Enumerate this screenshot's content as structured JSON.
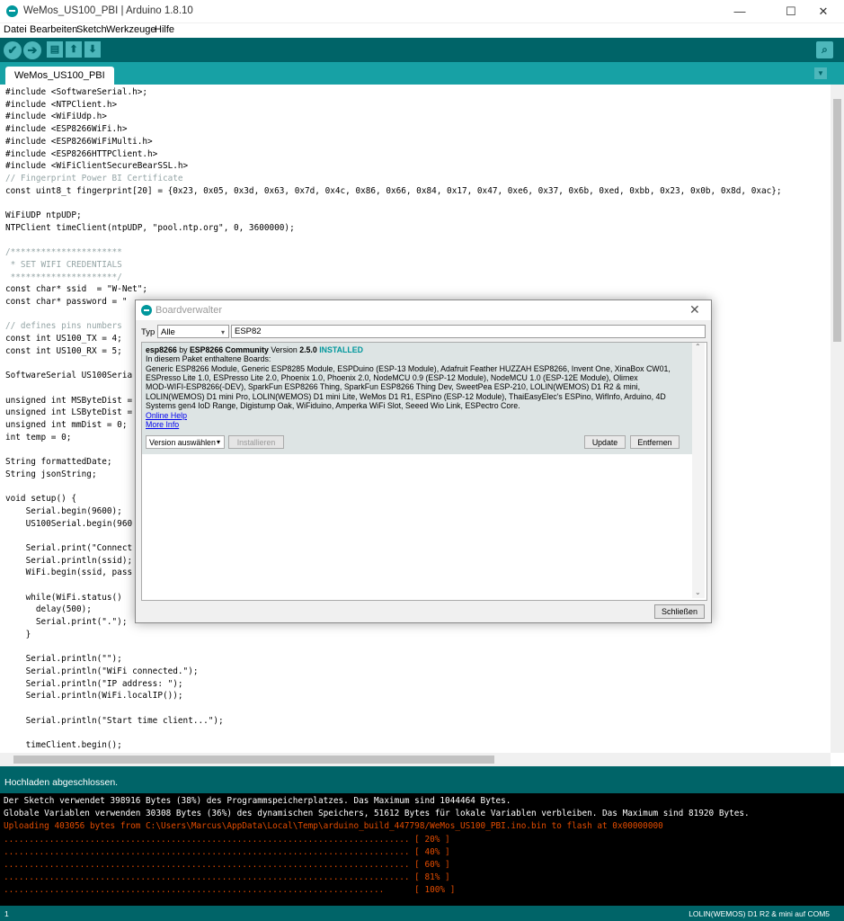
{
  "window": {
    "title": "WeMos_US100_PBI | Arduino 1.8.10",
    "minimize": "—",
    "maximize": "☐",
    "close": "✕"
  },
  "menu": [
    "Datei",
    "Bearbeiten",
    "Sketch",
    "Werkzeuge",
    "Hilfe"
  ],
  "toolbar": {
    "verify_icon": "✔",
    "upload_icon": "➔",
    "new_icon": "▤",
    "open_icon": "⬆",
    "save_icon": "⬇",
    "serial_icon": "⌕"
  },
  "tab": {
    "label": "WeMos_US100_PBI",
    "menu_icon": "▼"
  },
  "code_lines": [
    "#include <SoftwareSerial.h>;",
    "#include <NTPClient.h>",
    "#include <WiFiUdp.h>",
    "#include <ESP8266WiFi.h>",
    "#include <ESP8266WiFiMulti.h>",
    "#include <ESP8266HTTPClient.h>",
    "#include <WiFiClientSecureBearSSL.h>",
    "// Fingerprint Power BI Certificate",
    "const uint8_t fingerprint[20] = {0x23, 0x05, 0x3d, 0x63, 0x7d, 0x4c, 0x86, 0x66, 0x84, 0x17, 0x47, 0xe6, 0x37, 0x6b, 0xed, 0xbb, 0x23, 0x0b, 0x8d, 0xac};",
    "",
    "WiFiUDP ntpUDP;",
    "NTPClient timeClient(ntpUDP, \"pool.ntp.org\", 0, 3600000);",
    "",
    "/**********************",
    " * SET WIFI CREDENTIALS",
    " *********************/",
    "const char* ssid  = \"W-Net\";",
    "const char* password = \"",
    "",
    "// defines pins numbers",
    "const int US100_TX = 4;",
    "const int US100_RX = 5;",
    "",
    "SoftwareSerial US100Seria",
    "",
    "unsigned int MSByteDist =",
    "unsigned int LSByteDist =",
    "unsigned int mmDist = 0;",
    "int temp = 0;",
    "",
    "String formattedDate;",
    "String jsonString;",
    "",
    "void setup() {",
    "    Serial.begin(9600);",
    "    US100Serial.begin(960",
    "",
    "    Serial.print(\"Connect",
    "    Serial.println(ssid);",
    "    WiFi.begin(ssid, pass",
    "",
    "    while(WiFi.status()",
    "      delay(500);",
    "      Serial.print(\".\");",
    "    }",
    "",
    "    Serial.println(\"\");",
    "    Serial.println(\"WiFi connected.\");",
    "    Serial.println(\"IP address: \");",
    "    Serial.println(WiFi.localIP());",
    "",
    "    Serial.println(\"Start time client...\");",
    "",
    "    timeClient.begin();"
  ],
  "status": {
    "text": "Hochladen abgeschlossen."
  },
  "console": {
    "lines": [
      {
        "text": "Der Sketch verwendet 398916 Bytes (38%) des Programmspeicherplatzes. Das Maximum sind 1044464 Bytes.",
        "color": "white"
      },
      {
        "text": "Globale Variablen verwenden 30308 Bytes (36%) des dynamischen Speichers, 51612 Bytes für lokale Variablen verbleiben. Das Maximum sind 81920 Bytes.",
        "color": "white"
      },
      {
        "text": "Uploading 403056 bytes from C:\\Users\\Marcus\\AppData\\Local\\Temp\\arduino_build_447798/WeMos_US100_PBI.ino.bin to flash at 0x00000000",
        "color": "orange"
      },
      {
        "text": "................................................................................ [ 20% ]",
        "color": "orange"
      },
      {
        "text": "................................................................................ [ 40% ]",
        "color": "orange"
      },
      {
        "text": "................................................................................ [ 60% ]",
        "color": "orange"
      },
      {
        "text": "................................................................................ [ 81% ]",
        "color": "orange"
      },
      {
        "text": "...........................................................................      [ 100% ]",
        "color": "orange"
      }
    ]
  },
  "footer": {
    "line": "1",
    "board": "LOLIN(WEMOS) D1 R2 & mini auf COM5"
  },
  "dialog": {
    "title": "Boardverwalter",
    "close": "✕",
    "typ_label": "Typ",
    "typ_value": "Alle",
    "filter_value": "ESP82",
    "entry": {
      "name": "esp8266",
      "by": "by",
      "author": "ESP8266 Community",
      "version_label": "Version",
      "version": "2.5.0",
      "installed": "INSTALLED",
      "boards_heading": "In diesem Paket enthaltene Boards:",
      "boards_lines": [
        "Generic ESP8266 Module, Generic ESP8285 Module, ESPDuino (ESP-13 Module), Adafruit Feather HUZZAH ESP8266, Invent One, XinaBox CW01,",
        "ESPresso Lite 1.0, ESPresso Lite 2.0, Phoenix 1.0, Phoenix 2.0, NodeMCU 0.9 (ESP-12 Module), NodeMCU 1.0 (ESP-12E Module), Olimex",
        "MOD-WIFI-ESP8266(-DEV), SparkFun ESP8266 Thing, SparkFun ESP8266 Thing Dev, SweetPea ESP-210, LOLIN(WEMOS) D1 R2 & mini,",
        "LOLIN(WEMOS) D1 mini Pro, LOLIN(WEMOS) D1 mini Lite, WeMos D1 R1, ESPino (ESP-12 Module), ThaiEasyElec's ESPino, WifInfo, Arduino, 4D",
        "Systems gen4 IoD Range, Digistump Oak, WiFiduino, Amperka WiFi Slot, Seeed Wio Link, ESPectro Core."
      ],
      "online_help": "Online Help",
      "more_info": "More Info",
      "version_select": "Version auswählen",
      "install_button": "Installieren",
      "update_button": "Update",
      "remove_button": "Entfernen"
    },
    "close_button": "Schließen"
  }
}
